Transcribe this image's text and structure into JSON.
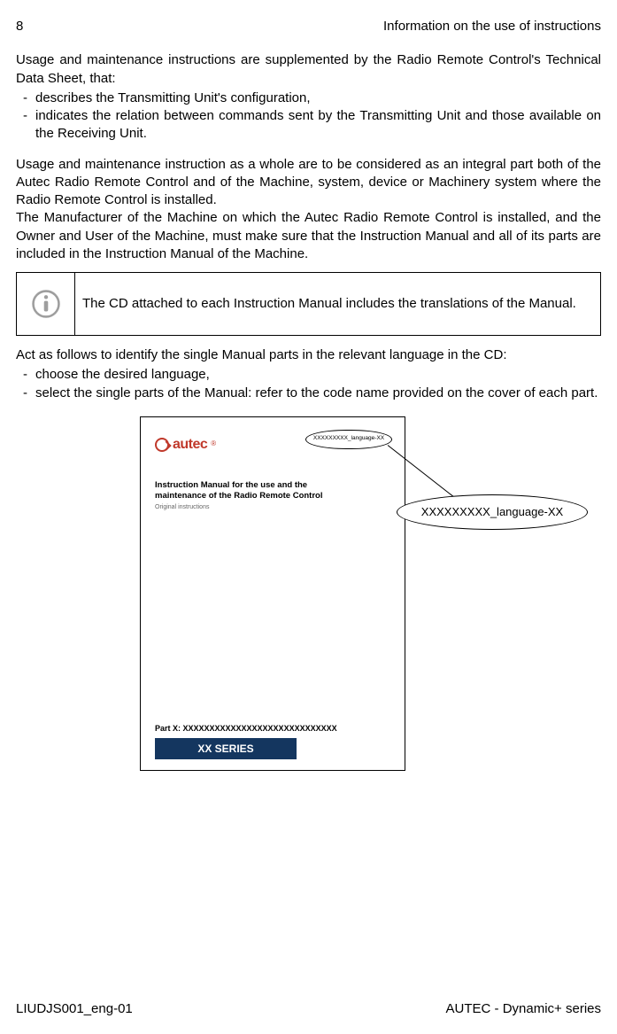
{
  "header": {
    "page_number": "8",
    "section_title": "Information on the use of instructions"
  },
  "body": {
    "p1": "Usage and maintenance instructions are supplemented by the Radio Remote Control's Technical Data Sheet, that:",
    "list1": {
      "i1": "describes the Transmitting Unit's configuration,",
      "i2": "indicates the relation between commands sent by the Transmitting Unit and those available on the Receiving Unit."
    },
    "p2": "Usage and maintenance instruction as a whole are to be considered as an integral part both of the Autec Radio Remote Control and of the Machine, system, device or Machinery system where the Radio Remote Control is installed.",
    "p3": "The Manufacturer of the Machine on which the Autec Radio Remote Control is installed, and the Owner and User of the Machine, must make sure that the Instruction Manual and all of its parts are included in the Instruction Manual of the Machine.",
    "info_note": "The CD attached to each Instruction Manual includes the translations of the Manual.",
    "p4": "Act as follows to identify the single Manual parts in the relevant language in the CD:",
    "list2": {
      "i1": "choose the desired language,",
      "i2": "select the single parts of the Manual: refer to the code name provided on the cover of each part."
    }
  },
  "figure": {
    "logo_text": "autec",
    "callout_small": "XXXXXXXXX_language-XX",
    "callout_big": "XXXXXXXXX_language-XX",
    "manual_title_l1": "Instruction Manual for the use and the",
    "manual_title_l2": "maintenance of the Radio Remote Control",
    "original": "Original instructions",
    "part_line": "Part X: XXXXXXXXXXXXXXXXXXXXXXXXXXXXX",
    "series": "XX SERIES"
  },
  "footer": {
    "doc_code": "LIUDJS001_eng-01",
    "product": "AUTEC - Dynamic+ series"
  }
}
